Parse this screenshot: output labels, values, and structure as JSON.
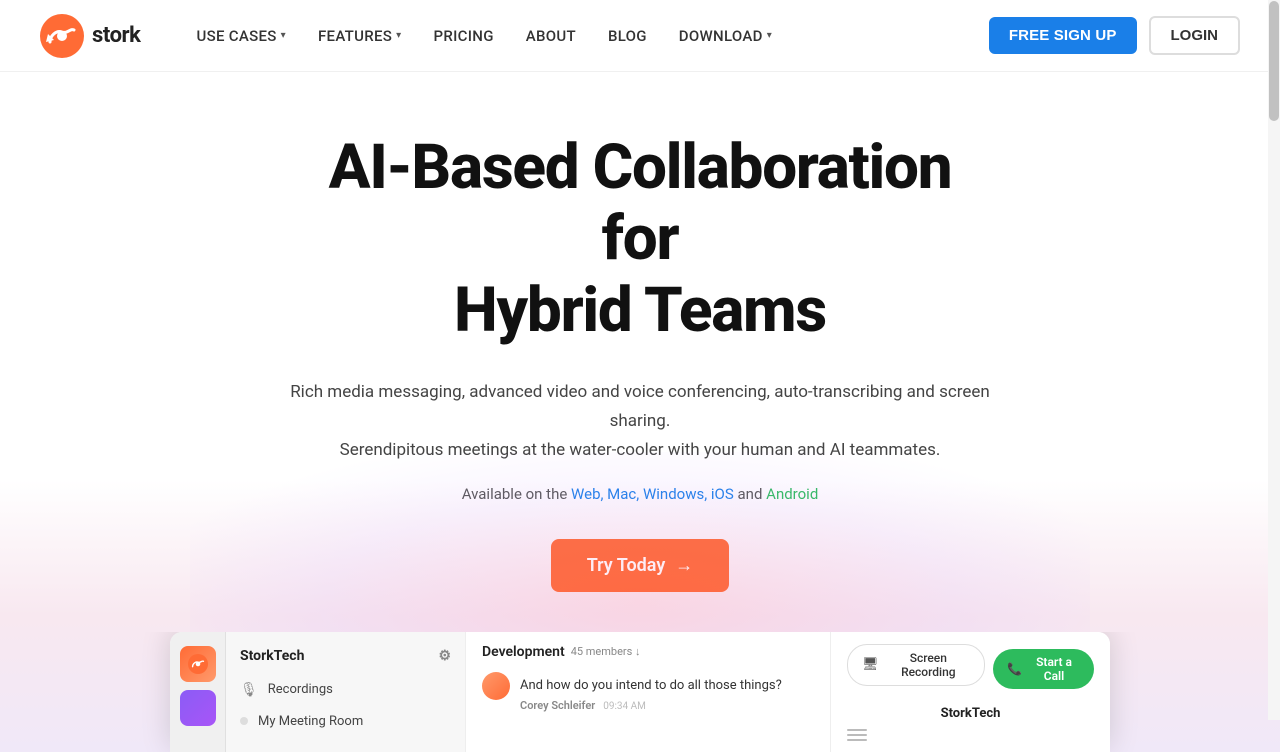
{
  "brand": {
    "name": "stork",
    "logo_alt": "Stork logo"
  },
  "nav": {
    "use_cases": "USE CASES",
    "features": "FEATURES",
    "pricing": "PRICING",
    "about": "ABOUT",
    "blog": "BLOG",
    "download": "DOWNLOAD",
    "free_signup": "FREE SIGN UP",
    "login": "LOGIN"
  },
  "hero": {
    "headline_line1": "AI-Based Collaboration",
    "headline_line2": "for",
    "headline_line3": "Hybrid Teams",
    "subtitle_line1": "Rich media messaging, advanced video and voice conferencing, auto-transcribing and screen sharing.",
    "subtitle_line2": "Serendipitous meetings at the water-cooler with your human and AI teammates.",
    "available_prefix": "Available on the",
    "available_links": "Web, Mac, Windows, iOS",
    "available_and": "and",
    "available_android": "Android",
    "cta_button": "Try Today",
    "cta_arrow": "→"
  },
  "app_preview": {
    "sidebar_company": "StorkTech",
    "sidebar_gear_icon": "⚙",
    "sidebar_recordings": "Recordings",
    "sidebar_meeting_room": "My Meeting Room",
    "channel_name": "Development",
    "channel_members": "45 members ↓",
    "chat_avatar_initials": "",
    "chat_message": "And how do you intend to do all those things?",
    "chat_sender": "Corey Schleifer",
    "chat_time": "09:34 AM",
    "screen_recording_label": "Screen Recording",
    "screen_icon": "▢",
    "start_call_label": "Start a Call",
    "phone_icon": "📞",
    "stork_panel_name": "StorkTech",
    "colors": {
      "orange": "#ff6b35",
      "blue": "#1a7fe8",
      "green": "#2dbb5d",
      "purple": "#8b5cf6"
    }
  }
}
